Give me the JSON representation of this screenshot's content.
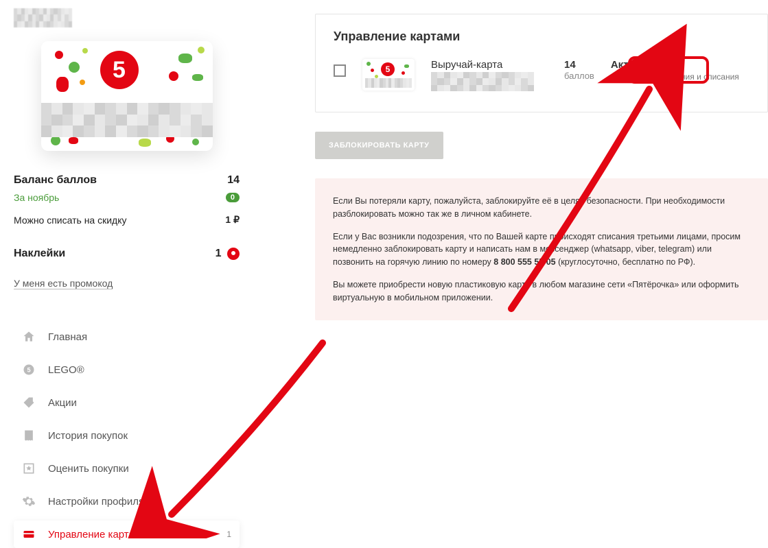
{
  "sidebar": {
    "balance": {
      "points_label": "Баланс баллов",
      "points_value": "14",
      "month_label": "За ноябрь",
      "month_badge": "0",
      "discount_label": "Можно списать на скидку",
      "discount_value": "1 ₽"
    },
    "stickers": {
      "label": "Наклейки",
      "value": "1"
    },
    "promo_link": "У меня есть промокод",
    "nav": [
      {
        "label": "Главная"
      },
      {
        "label": "LEGO®"
      },
      {
        "label": "Акции"
      },
      {
        "label": "История покупок"
      },
      {
        "label": "Оценить покупки"
      },
      {
        "label": "Настройки профиля"
      },
      {
        "label": "Управление картами",
        "badge": "1"
      }
    ]
  },
  "main": {
    "title": "Управление картами",
    "card": {
      "name": "Выручай-карта",
      "points_value": "14",
      "points_label": "баллов",
      "status": "Активна",
      "status_sub": "доступны начисления и списания"
    },
    "block_button": "ЗАБЛОКИРОВАТЬ КАРТУ",
    "info": {
      "p1": "Если Вы потеряли карту, пожалуйста, заблокируйте её в целях безопасности. При необходимости разблокировать можно так же в личном кабинете.",
      "p2a": "Если у Вас возникли подозрения, что по Вашей карте происходят списания третьими лицами, просим немедленно заблокировать карту и написать нам в мессенджер (whatsapp, viber, telegram) или позвонить на горячую линию по номеру ",
      "p2_phone": "8 800 555 55 05",
      "p2b": " (круглосуточно, бесплатно по РФ).",
      "p3": "Вы можете приобрести новую пластиковую карту в любом магазине сети «Пятёрочка» или оформить виртуальную в мобильном приложении."
    }
  },
  "colors": {
    "accent": "#e30613",
    "green": "#4a9c3a"
  }
}
